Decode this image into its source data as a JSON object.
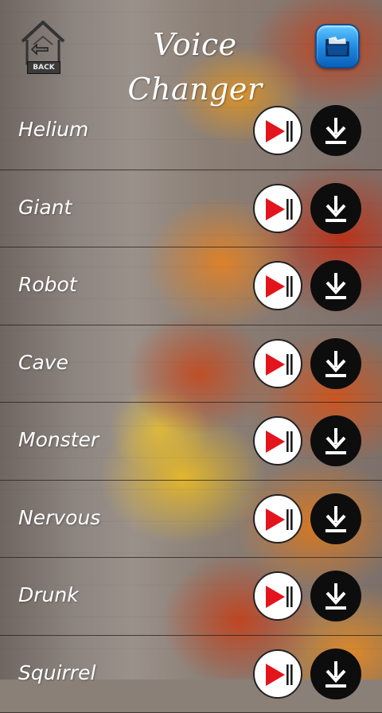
{
  "header": {
    "title": "Voice Changer",
    "back_label": "BACK",
    "back_icon": "home-back-icon",
    "folder_icon": "folder-icon"
  },
  "effects": [
    {
      "label": "Helium"
    },
    {
      "label": "Giant"
    },
    {
      "label": "Robot"
    },
    {
      "label": "Cave"
    },
    {
      "label": "Monster"
    },
    {
      "label": "Nervous"
    },
    {
      "label": "Drunk"
    },
    {
      "label": "Squirrel"
    }
  ],
  "icons": {
    "play": "play-pause-icon",
    "download": "download-icon"
  },
  "colors": {
    "play_red": "#e4141c",
    "download_bg": "#0d0d0d",
    "folder_blue": "#1e86e0"
  }
}
